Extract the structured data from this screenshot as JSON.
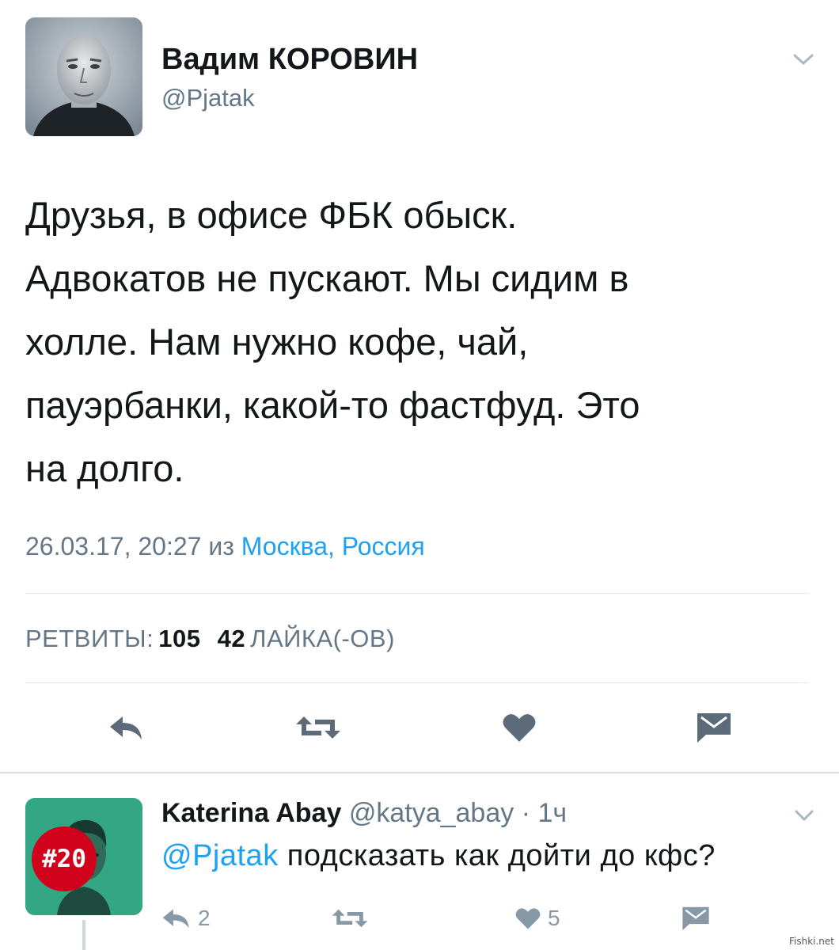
{
  "tweet": {
    "author_name": "Вадим КОРОВИН",
    "author_handle": "@Pjatak",
    "avatar_icon": "author-photo",
    "text_lines": [
      "Друзья, в офисе ФБК обыск.",
      "Адвокатов не пускают. Мы сидим в",
      "холле. Нам нужно кофе, чай,",
      "пауэрбанки, какой-то фастфуд. Это",
      "на долго."
    ],
    "timestamp": "26.03.17, 20:27",
    "from_label": "из",
    "location": "Москва, Россия",
    "stats": {
      "retweets_label": "РЕТВИТЫ:",
      "retweets_count": "105",
      "likes_count": "42",
      "likes_label": "ЛАЙКА(-ОВ)"
    },
    "actions": [
      "reply-icon",
      "retweet-icon",
      "heart-icon",
      "message-icon"
    ]
  },
  "reply": {
    "name": "Katerina Abay",
    "handle": "@katya_abay",
    "separator": "·",
    "time": "1ч",
    "badge": "#20",
    "mention": "@Pjatak",
    "text": "подсказать как дойти до кфс?",
    "reply_count": "2",
    "like_count": "5"
  },
  "colors": {
    "link": "#1da1f2",
    "secondary_text": "#657786",
    "action_icon": "#5b6b7a",
    "reply_avatar_bg": "#33a683",
    "badge_red": "#d0021b"
  },
  "watermark": "Fishki.net"
}
